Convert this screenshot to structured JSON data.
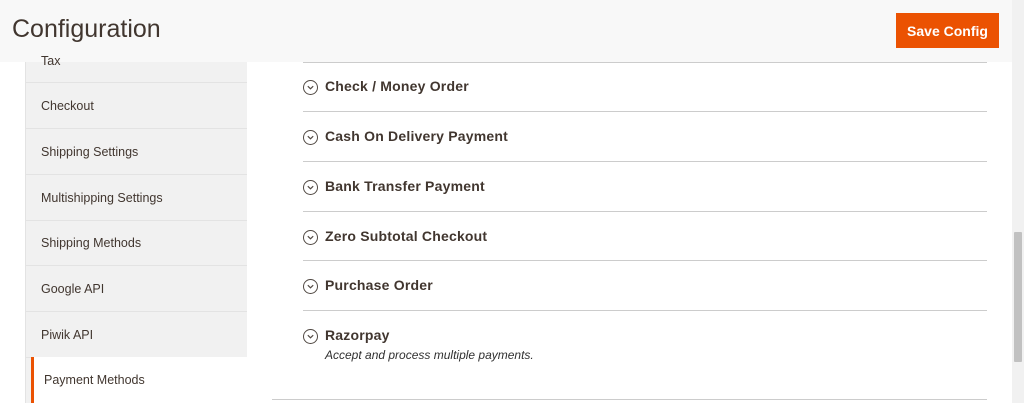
{
  "header": {
    "title": "Configuration",
    "save_label": "Save Config"
  },
  "sidebar": {
    "items": [
      {
        "label": "Tax"
      },
      {
        "label": "Checkout"
      },
      {
        "label": "Shipping Settings"
      },
      {
        "label": "Multishipping Settings"
      },
      {
        "label": "Shipping Methods"
      },
      {
        "label": "Google API"
      },
      {
        "label": "Piwik API"
      },
      {
        "label": "Payment Methods"
      }
    ],
    "active_index": 7
  },
  "sections": [
    {
      "title": "Check / Money Order",
      "description": ""
    },
    {
      "title": "Cash On Delivery Payment",
      "description": ""
    },
    {
      "title": "Bank Transfer Payment",
      "description": ""
    },
    {
      "title": "Zero Subtotal Checkout",
      "description": ""
    },
    {
      "title": "Purchase Order",
      "description": ""
    },
    {
      "title": "Razorpay",
      "description": "Accept and process multiple payments."
    }
  ],
  "colors": {
    "accent": "#eb5202",
    "sidebar_bg": "#f1f1f1",
    "header_bg": "#f8f8f8",
    "text": "#41362f"
  }
}
